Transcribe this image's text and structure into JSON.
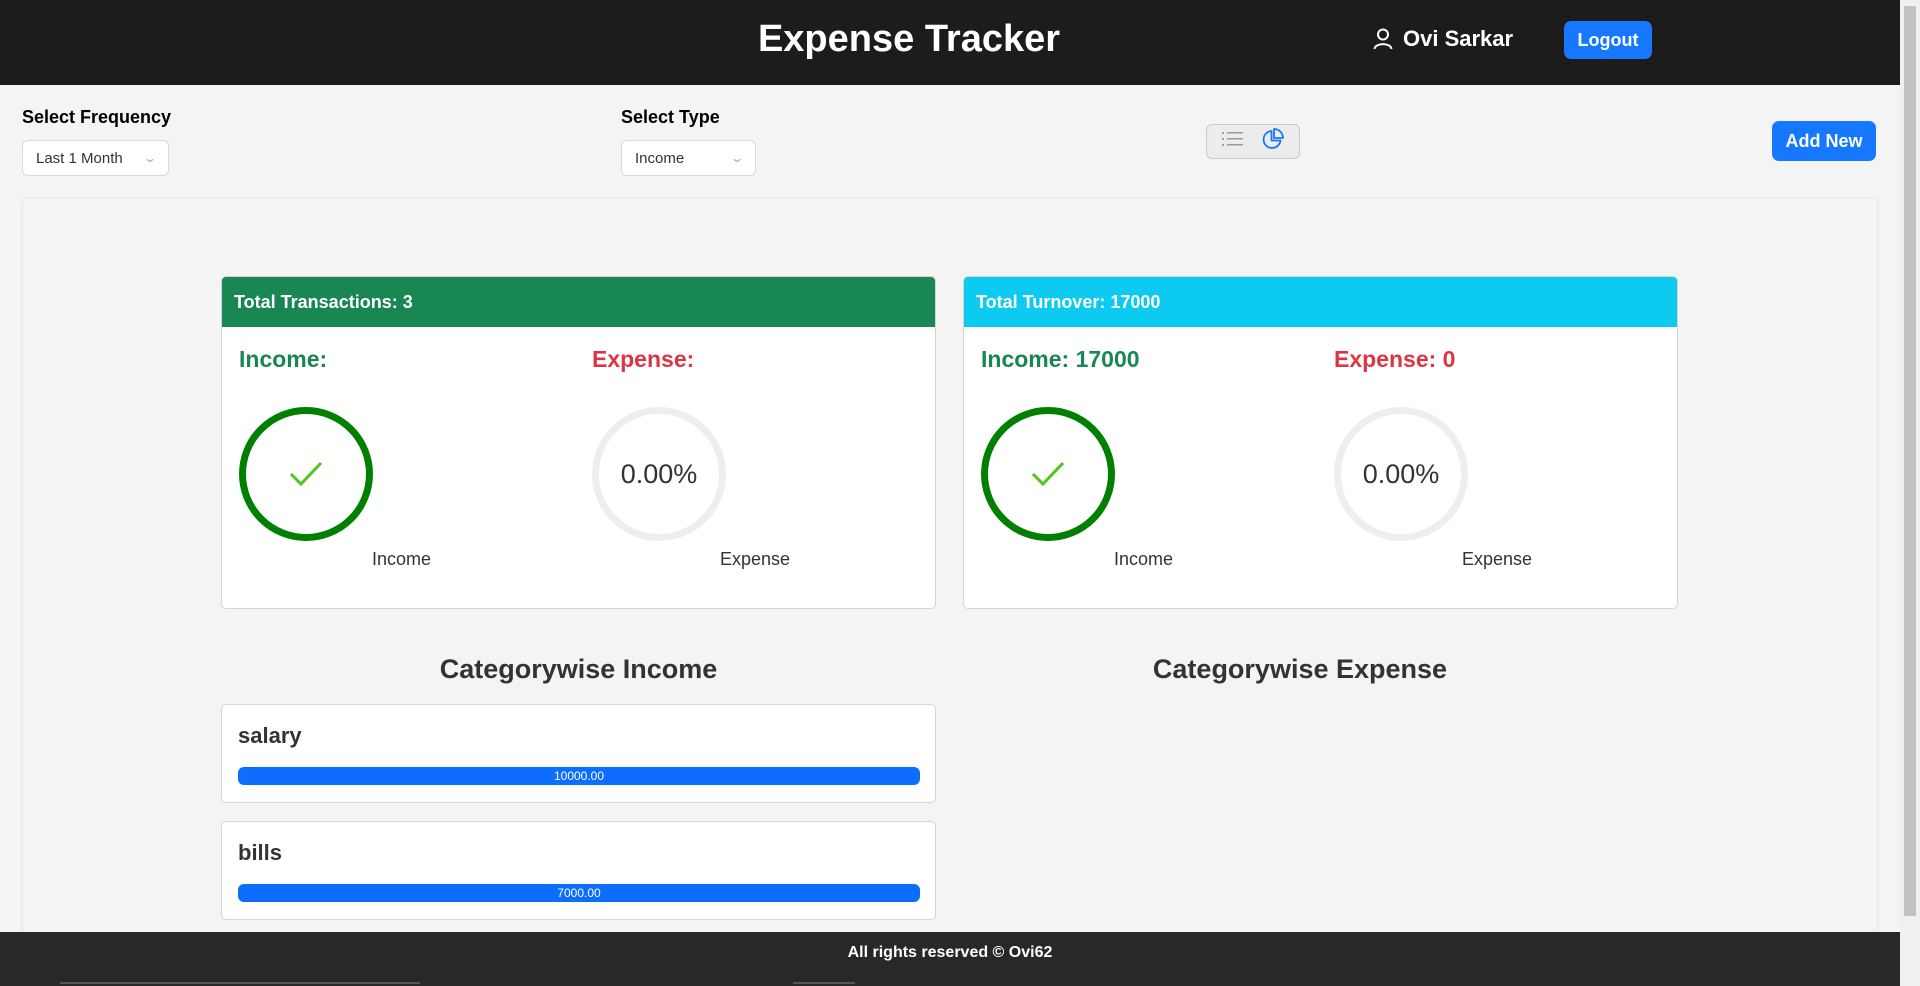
{
  "header": {
    "title": "Expense Tracker",
    "user_name": "Ovi Sarkar",
    "logout_label": "Logout"
  },
  "filters": {
    "frequency_label": "Select Frequency",
    "frequency_value": "Last 1 Month",
    "type_label": "Select Type",
    "type_value": "Income",
    "add_new_label": "Add New",
    "view_toggle": {
      "list_icon": "list-icon",
      "chart_icon": "pie-chart-icon",
      "active": "chart"
    }
  },
  "transactions_card": {
    "header": "Total Transactions: 3",
    "income_label": "Income:",
    "expense_label": "Expense:",
    "income_caption": "Income",
    "expense_caption": "Expense",
    "income_percent": 100,
    "expense_percent_text": "0.00%"
  },
  "turnover_card": {
    "header": "Total Turnover: 17000",
    "income_label": "Income: 17000",
    "expense_label": "Expense: 0",
    "income_caption": "Income",
    "expense_caption": "Expense",
    "income_percent": 100,
    "expense_percent_text": "0.00%"
  },
  "categorywise_income": {
    "title": "Categorywise Income",
    "items": [
      {
        "name": "salary",
        "value_text": "10000.00",
        "percent": 100
      },
      {
        "name": "bills",
        "value_text": "7000.00",
        "percent": 100
      }
    ]
  },
  "categorywise_expense": {
    "title": "Categorywise Expense",
    "items": []
  },
  "footer": {
    "text": "All rights reserved © Ovi62"
  },
  "colors": {
    "header_bg": "#1c1c1c",
    "primary": "#1677ff",
    "income_green": "#198754",
    "expense_red": "#dc3545",
    "turnover_cyan": "#0dcaf0",
    "progress_ok": "#008000",
    "bar_fill": "#0d6efd"
  }
}
